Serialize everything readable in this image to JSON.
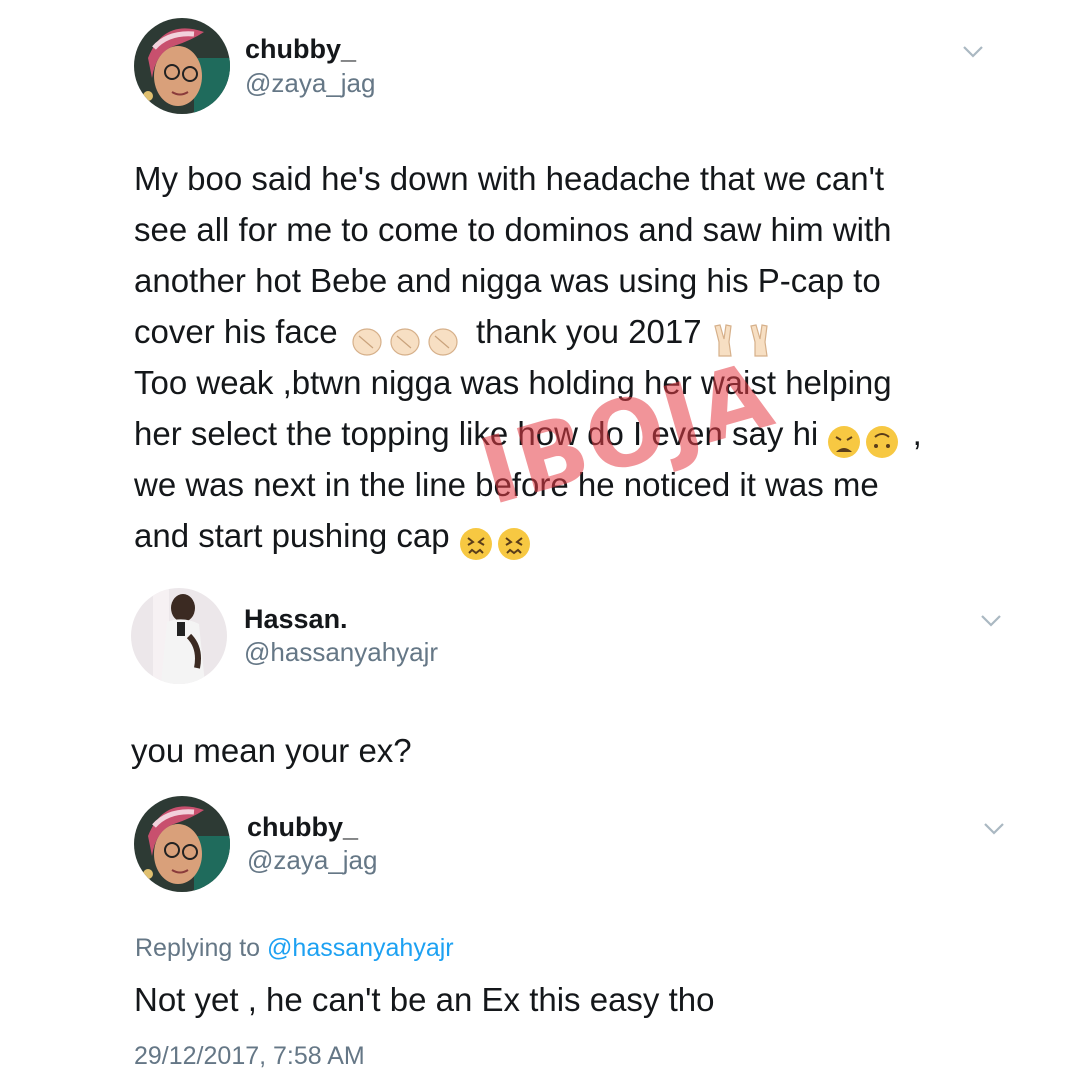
{
  "tweets": [
    {
      "display_name": "chubby_",
      "handle": "@zaya_jag",
      "lines": [
        "My boo said he's down with headache that we can't",
        "see all for me to come to dominos and saw him with",
        "another hot Bebe and nigga was using his P-cap to",
        "cover his face",
        "thank you 2017",
        "Too weak ,btwn nigga was holding her waist helping",
        "her select the topping like how do I even say hi",
        ",",
        "we was next in the line before he noticed it was me",
        "and start pushing cap"
      ],
      "emoji": [
        "clapping-hands",
        "victory-hand",
        "weary-face",
        "upside-down-face",
        "confounded-face"
      ]
    },
    {
      "display_name": "Hassan.",
      "handle": "@hassanyahyajr",
      "text": "you mean your ex?"
    },
    {
      "display_name": "chubby_",
      "handle": "@zaya_jag",
      "replying_label": "Replying to",
      "replying_to": "@hassanyahyajr",
      "text": "Not yet , he can't be an Ex this easy tho",
      "timestamp": "29/12/2017, 7:58 AM"
    }
  ],
  "watermark": "IBOJA",
  "colors": {
    "text": "#14171a",
    "secondary": "#657786",
    "link": "#1da1f2",
    "watermark": "#e63c46"
  }
}
